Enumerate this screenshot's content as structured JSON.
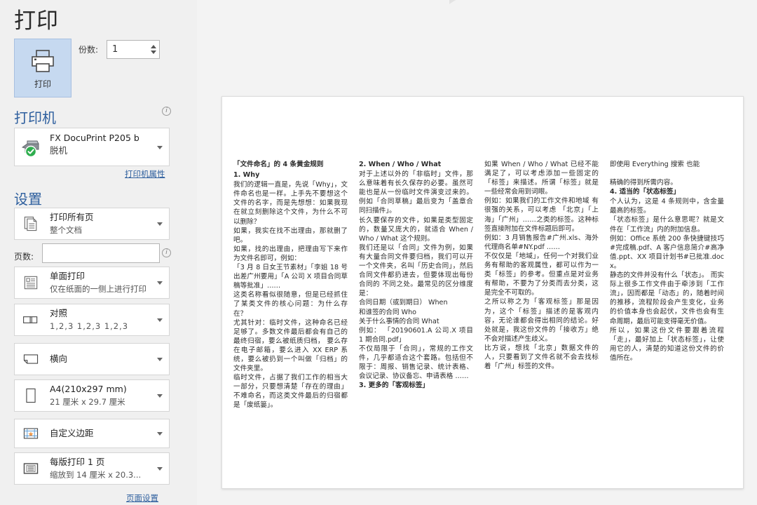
{
  "page_title": "打印",
  "print_button": {
    "label": "打印",
    "icon": "printer-icon"
  },
  "copies": {
    "label": "份数:",
    "value": "1"
  },
  "printer": {
    "heading": "打印机",
    "name": "FX DocuPrint P205 b",
    "status": "脱机",
    "properties_link": "打印机属性",
    "info_icon": "info-icon"
  },
  "settings": {
    "heading": "设置",
    "pages_label": "页数:",
    "pages_value": "",
    "page_setup_link": "页面设置",
    "rows": [
      {
        "icon": "document-pages-icon",
        "title": "打印所有页",
        "sub": "整个文档"
      },
      {
        "icon": "one-sided-icon",
        "title": "单面打印",
        "sub": "仅在纸面的一侧上进行打印"
      },
      {
        "icon": "collate-icon",
        "title": "对照",
        "sub": "1,2,3   1,2,3   1,2,3"
      },
      {
        "icon": "landscape-icon",
        "title": "横向",
        "sub": ""
      },
      {
        "icon": "paper-size-icon",
        "title": "A4(210x297 mm)",
        "sub": "21 厘米 x 29.7 厘米"
      },
      {
        "icon": "custom-margins-icon",
        "title": "自定义边距",
        "sub": ""
      },
      {
        "icon": "pages-per-sheet-icon",
        "title": "每版打印 1 页",
        "sub": "缩放到 14 厘米 x 20.3..."
      }
    ]
  },
  "document": {
    "title": "「文件命名」的 4 条黄金规则",
    "columns": [
      {
        "blocks": [
          {
            "type": "heading",
            "text": "1.   Why"
          },
          {
            "type": "para",
            "text": "我们的逻辑一直是，先说「Why」，文件命名也是一样。上手先不要想这个文件的名字，而是先想想：如果我现在就立刻删除这个文件，为什么不可以删除？"
          },
          {
            "type": "para",
            "text": "如果，我实在找不出理由，那就删了吧。"
          },
          {
            "type": "para",
            "text": "如果，找的出理由，把理由写下来作为文件名即可，例如："
          },
          {
            "type": "para",
            "text": "「3 月 8 日女王节素材」「李姐 18 号出差广州要用」「A 公司 X 项目合同草稿等批准」……"
          },
          {
            "type": "para",
            "text": "这类名称看似很随意，但是已经抓住了某类文件的核心问题：为什么存在？"
          },
          {
            "type": "para",
            "text": "尤其针对：临时文件，这种命名已经足够了。多数文件最后都会有自己的最终归宿，要么被纸质归档， 要么存在电子邮箱，要么进入 XX ERP 系统，要么被扔到一个叫做「归档」的文件夹里。"
          },
          {
            "type": "para",
            "text": "临时文件，占据了我们工作的相当大一部分，只要想清楚「存在的理由」不难命名，而这类文件最后的归宿都是「废纸篓」。"
          }
        ]
      },
      {
        "blocks": [
          {
            "type": "heading",
            "text": "2. When / Who / What"
          },
          {
            "type": "para",
            "text": "对于上述以外的「非临时」文件，那么意味着有长久保存的必要。虽然可能也是从一份临时文件演变过来的。例如「合同草稿」最后变为「盖章合同扫描件」。"
          },
          {
            "type": "para",
            "text": "长久要保存的文件，如果是类型固定的，数量又庞大的，就适合 When / Who / What 这个规则。"
          },
          {
            "type": "para",
            "text": "我们还是以「合同」文件为例，如果有大量合同文件要归档，我们可以开一个文件夹，名叫「历史合同」，然后合同文件都扔进去，但要体现出每份合同的 不同之处。最常见的区分维度是："
          },
          {
            "type": "para",
            "text": "合同日期（或到期日） When"
          },
          {
            "type": "para",
            "text": "和谁签的合同  Who"
          },
          {
            "type": "para",
            "text": "关于什么事情的合同  What"
          },
          {
            "type": "para",
            "text": "例如： 「20190601.A 公司.X 项目 1 期合同.pdf」"
          },
          {
            "type": "para",
            "text": "不仅局限于「合同」，常规的工作文件，几乎都适合这个套路。包括但不限于：周报、销售记录、统计表格、会议记录、协议备忘、申请表格 ……"
          },
          {
            "type": "heading",
            "text": "3. 更多的「客观标签」"
          }
        ]
      },
      {
        "blocks": [
          {
            "type": "para",
            "text": "如果 When / Who / What 已经不能满足了，可以考虑添加一些固定的「标签」来描述。所谓「标签」就是一些经常会用到词眼。"
          },
          {
            "type": "para",
            "text": "例如：如果我们的工作文件和地域 有很强的关系，可以考虑 「北京」「上海」「广州」……之类的标签。这种标签直接附加在文件标题后即可。"
          },
          {
            "type": "para",
            "text": "例如：3 月销售报告#广州.xls、海外代理商名单#NY.pdf ……"
          },
          {
            "type": "para",
            "text": "不仅仅是「地域」，任何一个对我们业务有帮助的客观属性，都可以作为一类「标签」的参考。但重点是对业务有帮助，不要为了分类而去分类，这是完全不可取的。"
          },
          {
            "type": "para",
            "text": "之所以称之为「客观标签」那是因为，这个「标签」描述的是客观内容，无论谁都会得出相同的结论。好处就是，我这份文件的「接收方」绝不会对描述产生歧义。"
          },
          {
            "type": "para",
            "text": "比方说，想找「北京」数据文件的人，只要看到了文件名就不会去找标着「广州」标签的文件。"
          }
        ]
      },
      {
        "blocks": [
          {
            "type": "para",
            "text": "即使用 Everything 搜索 也能"
          },
          {
            "type": "gap",
            "text": ""
          },
          {
            "type": "para",
            "text": "精确的得到所需内容。"
          },
          {
            "type": "heading",
            "text": "4. 适当的「状态标签」"
          },
          {
            "type": "para",
            "text": "个人认为，这是 4 条规则中，含金量最高的标签。"
          },
          {
            "type": "para",
            "text": "「状态标签」是什么意思呢？就是文件在「工作流」内的附加信息。"
          },
          {
            "type": "para",
            "text": "例如：Office 系统 200 条快捷键技巧#完成稿.pdf、A 客户信息简介#高净值.ppt、XX 项目计划书#已批准.docx。"
          },
          {
            "type": "para",
            "text": "静态的文件并没有什么「状态」。 而实际上很多工作文件由于牵涉到「工作流」，因而都是「动态」的，随着时间的推移，流程阶段会产生变化，业务的价值本身也会起伏，文件也会有生命周期，最后可能变得毫无价值。"
          },
          {
            "type": "para",
            "text": "所以，如果这份文件要跟着流程「走」，最好加上「状态标签」，让使用它的人，清楚的知道这份文件的价值所在。"
          }
        ]
      }
    ]
  },
  "colors": {
    "accent_blue": "#2e5f9e",
    "print_button_bg": "#c6d9f0",
    "heading_orange": "#e8a33d",
    "panel_bg": "#f0f0f0",
    "preview_bg": "#f3f3f3"
  }
}
